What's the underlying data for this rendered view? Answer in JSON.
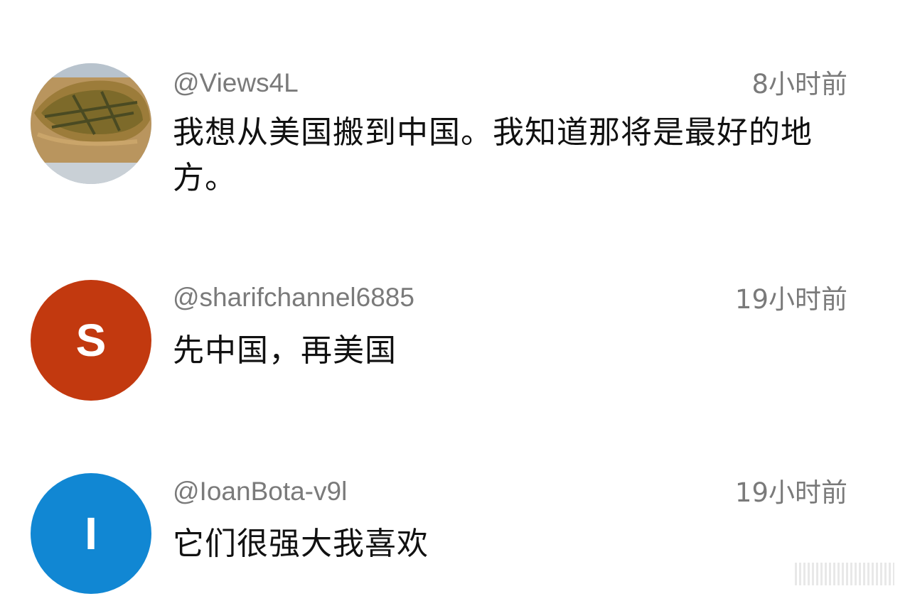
{
  "comments": [
    {
      "handle": "@Views4L",
      "time": "8小时前",
      "text": "我想从美国搬到中国。我知道那将是最好的地方。",
      "avatar": {
        "type": "photo",
        "icon": "bread-photo"
      }
    },
    {
      "handle": "@sharifchannel6885",
      "time": "19小时前",
      "text": "先中国，再美国",
      "avatar": {
        "type": "letter",
        "letter": "S",
        "color": "#c2390f"
      }
    },
    {
      "handle": "@IoanBota-v9l",
      "time": "19小时前",
      "text": "它们很强大我喜欢",
      "avatar": {
        "type": "letter",
        "letter": "I",
        "color": "#1187d3"
      }
    }
  ]
}
